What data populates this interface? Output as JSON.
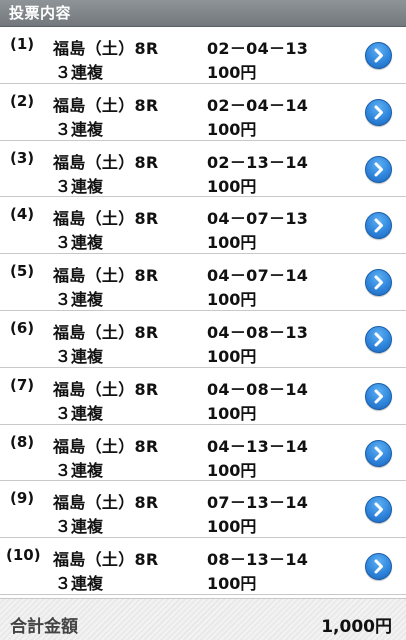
{
  "header": {
    "title": "投票内容"
  },
  "bets": [
    {
      "index": "(1)",
      "race": "福島（土）8R",
      "type": "３連複",
      "combination": "02－04－13",
      "amount": "100円"
    },
    {
      "index": "(2)",
      "race": "福島（土）8R",
      "type": "３連複",
      "combination": "02－04－14",
      "amount": "100円"
    },
    {
      "index": "(3)",
      "race": "福島（土）8R",
      "type": "３連複",
      "combination": "02－13－14",
      "amount": "100円"
    },
    {
      "index": "(4)",
      "race": "福島（土）8R",
      "type": "３連複",
      "combination": "04－07－13",
      "amount": "100円"
    },
    {
      "index": "(5)",
      "race": "福島（土）8R",
      "type": "３連複",
      "combination": "04－07－14",
      "amount": "100円"
    },
    {
      "index": "(6)",
      "race": "福島（土）8R",
      "type": "３連複",
      "combination": "04－08－13",
      "amount": "100円"
    },
    {
      "index": "(7)",
      "race": "福島（土）8R",
      "type": "３連複",
      "combination": "04－08－14",
      "amount": "100円"
    },
    {
      "index": "(8)",
      "race": "福島（土）8R",
      "type": "３連複",
      "combination": "04－13－14",
      "amount": "100円"
    },
    {
      "index": "(9)",
      "race": "福島（土）8R",
      "type": "３連複",
      "combination": "07－13－14",
      "amount": "100円"
    },
    {
      "index": "(10)",
      "race": "福島（土）8R",
      "type": "３連複",
      "combination": "08－13－14",
      "amount": "100円"
    }
  ],
  "total": {
    "label": "合計金額",
    "value": "1,000円"
  },
  "icons": {
    "row_action": "chevron-right-circle-icon"
  },
  "colors": {
    "accent": "#2f86dc",
    "header_bg": "#7f8588"
  }
}
